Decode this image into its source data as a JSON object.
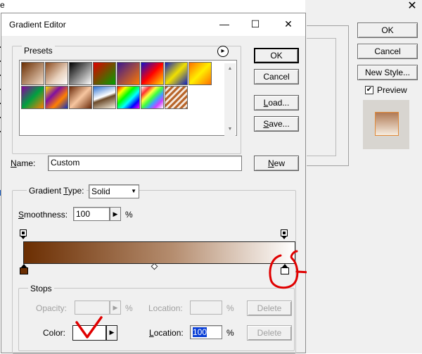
{
  "background_dialog": {
    "left_text": "e",
    "ok_label": "OK",
    "cancel_label": "Cancel",
    "new_style_label": "New Style...",
    "preview_label": "Preview",
    "preview_checked": true,
    "close_glyph": "✕"
  },
  "window": {
    "title": "Gradient Editor",
    "minimize_glyph": "—",
    "maximize_glyph": "☐",
    "close_glyph": "✕"
  },
  "presets": {
    "label": "Presets",
    "menu_glyph": "▸",
    "scroll_up_glyph": "▲",
    "scroll_down_glyph": "▼",
    "swatches": [
      {
        "name": "foreground-to-background",
        "css": "linear-gradient(135deg,#6b2e02,#f2dcc8)"
      },
      {
        "name": "foreground-to-transparent",
        "css": "linear-gradient(135deg,#8a4a1e,#e8d1bd 60%,#ffffff)"
      },
      {
        "name": "black-white",
        "css": "linear-gradient(135deg,#000000,#ffffff)"
      },
      {
        "name": "red-green",
        "css": "linear-gradient(135deg,#e00000,#00a000)"
      },
      {
        "name": "violet-orange",
        "css": "linear-gradient(135deg,#3a1890,#ff7a00)"
      },
      {
        "name": "blue-red-yellow",
        "css": "linear-gradient(135deg,#1010d0,#ff0000 50%,#ffe000)"
      },
      {
        "name": "blue-yellow-blue",
        "css": "linear-gradient(135deg,#1020c0,#f0e000 50%,#1020c0)"
      },
      {
        "name": "orange-yellow-orange",
        "css": "linear-gradient(135deg,#ff7000,#ffee00 50%,#ff7000)"
      },
      {
        "name": "violet-green-orange",
        "css": "linear-gradient(135deg,#8a00a0,#00a040 50%,#ff8000)"
      },
      {
        "name": "yellow-violet-orange-blue",
        "css": "linear-gradient(135deg,#ffe000,#8010a0 35%,#ff8000 65%,#1030c0)"
      },
      {
        "name": "copper",
        "css": "linear-gradient(135deg,#6a2a0a,#f7c6a0 50%,#6a2a0a)"
      },
      {
        "name": "chrome",
        "css": "linear-gradient(160deg,#2a6fd0,#ffffff 45%,#6b4a2a 55%,#f5f0e0)"
      },
      {
        "name": "spectrum",
        "css": "linear-gradient(135deg,#ff0000,#ffff00 20%,#00ff00 40%,#00ffff 60%,#0000ff 80%,#ff00ff)"
      },
      {
        "name": "transparent-rainbow",
        "css": "linear-gradient(135deg,#ffffff,#ff3030 20%,#ffff40 35%,#40ff40 50%,#40a0ff 65%,#d040ff 80%,#ffffff)"
      },
      {
        "name": "transparent-stripes",
        "css": "repeating-linear-gradient(135deg,#b8652a 0px,#b8652a 3px,#f5e9df 3px,#f5e9df 6px)"
      }
    ]
  },
  "buttons": {
    "ok_label": "OK",
    "cancel_label": "Cancel",
    "load_label": "Load...",
    "save_label": "Save...",
    "new_label": "New"
  },
  "name_field": {
    "label": "Name:",
    "value": "Custom"
  },
  "gradient_type": {
    "label": "Gradient Type:",
    "value": "Solid",
    "arrow_glyph": "▼"
  },
  "smoothness": {
    "label": "Smoothness:",
    "value": "100",
    "unit": "%",
    "arrow_glyph": "▶"
  },
  "gradient": {
    "start_color": "#6b2e02",
    "mid_color": "#b58d6f",
    "end_color": "#ffffff"
  },
  "stops": {
    "label": "Stops",
    "opacity_label": "Opacity:",
    "opacity_unit": "%",
    "opacity_location_label": "Location:",
    "opacity_location_unit": "%",
    "opacity_delete_label": "Delete",
    "color_label": "Color:",
    "color_value": "#ffffff",
    "color_location_label": "Location:",
    "color_location_value": "100",
    "color_location_unit": "%",
    "color_delete_label": "Delete",
    "arrow_glyph": "▶"
  },
  "annotations": {
    "circle_color": "#e00000",
    "checkmark_color": "#e00000"
  }
}
